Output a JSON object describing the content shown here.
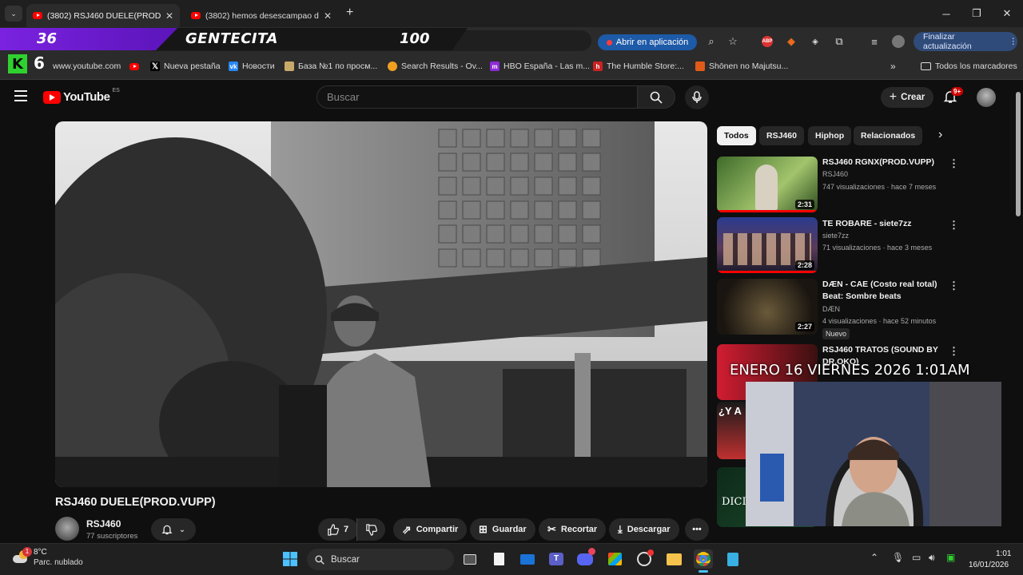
{
  "browser": {
    "tabs": [
      {
        "title": "(3802) RSJ460 DUELE(PROD.VUPP)",
        "active": true
      },
      {
        "title": "(3802) hemos desescampao de",
        "active": false
      }
    ],
    "open_in_app_label": "Abrir en aplicación",
    "update_label": "Finalizar actualización",
    "url_partial": "watch"
  },
  "stream_overlay": {
    "left_number": "36",
    "name": "GENTECITA",
    "right_number": "100",
    "badge_number": "6",
    "date_banner": "ENERO 16 VIERNES 2026 1:01AM",
    "banner_partial": "¿Y A",
    "banner_partial2": "DICI"
  },
  "bookmarks": [
    {
      "label": "www.youtube.com",
      "icon": "youtube-icon"
    },
    {
      "label": "",
      "icon": "youtube-icon"
    },
    {
      "label": "Nueva pestaña",
      "icon": "x-icon"
    },
    {
      "label": "Новости",
      "icon": "vk-icon"
    },
    {
      "label": "База №1 по просм...",
      "icon": "site-icon"
    },
    {
      "label": "Search Results - Ov...",
      "icon": "search-site-icon"
    },
    {
      "label": "HBO España - Las m...",
      "icon": "hbo-icon"
    },
    {
      "label": "The Humble Store:...",
      "icon": "humble-icon"
    },
    {
      "label": "Shōnen no Majutsu...",
      "icon": "site-icon"
    }
  ],
  "bookmarks_all": "Todos los marcadores",
  "youtube": {
    "logo": "YouTube",
    "region": "ES",
    "search_placeholder": "Buscar",
    "create_label": "Crear",
    "notifications": "9+",
    "video_title": "RSJ460 DUELE(PROD.VUPP)",
    "channel": "RSJ460",
    "subscribers": "77 suscriptores",
    "likes": "7",
    "actions": [
      "Compartir",
      "Guardar",
      "Recortar",
      "Descargar"
    ],
    "chips": [
      "Todos",
      "RSJ460",
      "Hiphop",
      "Relacionados"
    ],
    "related": [
      {
        "title": "RSJ460 RGNX(PROD.VUPP)",
        "channel": "RSJ460",
        "meta": "747 visualizaciones · hace 7 meses",
        "duration": "2:31",
        "badge": ""
      },
      {
        "title": "TE ROBARE - siete7zz",
        "channel": "siete7zz",
        "meta": "71 visualizaciones · hace 3 meses",
        "duration": "2:28",
        "badge": ""
      },
      {
        "title": "DÆN - CAE (Costo real total) Beat: Sombre beats",
        "channel": "DÆN",
        "meta": "4 visualizaciones · hace 52 minutos",
        "duration": "2:27",
        "badge": "Nuevo"
      },
      {
        "title": "RSJ460 TRATOS (SOUND BY DR.OKO)",
        "channel": "",
        "meta": "",
        "duration": "",
        "badge": ""
      }
    ]
  },
  "taskbar": {
    "temp": "8°C",
    "weather": "Parc. nublado",
    "search": "Buscar",
    "time": "1:01",
    "date": "16/01/2026",
    "weather_badge": "1"
  }
}
